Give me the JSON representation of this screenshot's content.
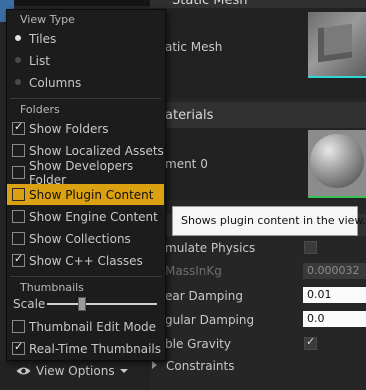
{
  "background": {
    "header_partial": "Static Mesh",
    "mesh_label_partial": "atic Mesh",
    "materials_header_partial": "aterials",
    "element_label_partial": "ment 0",
    "props": [
      {
        "label": "mulate Physics",
        "type": "check",
        "checked": false
      },
      {
        "label": "MassInKg",
        "type": "field",
        "value": "0.000032",
        "dim": true
      },
      {
        "label": "ear Damping",
        "type": "field",
        "value": "0.01"
      },
      {
        "label": "gular Damping",
        "type": "field",
        "value": "0.0"
      },
      {
        "label": "ble Gravity",
        "type": "check",
        "checked": true
      }
    ],
    "constraints_label": "Constraints"
  },
  "menu": {
    "view_type": {
      "title": "View Type",
      "options": [
        {
          "label": "Tiles",
          "selected": true
        },
        {
          "label": "List",
          "selected": false
        },
        {
          "label": "Columns",
          "selected": false
        }
      ]
    },
    "folders": {
      "title": "Folders",
      "items": [
        {
          "label": "Show Folders",
          "checked": true
        },
        {
          "label": "Show Localized Assets",
          "checked": false
        },
        {
          "label": "Show Developers Folder",
          "checked": false
        },
        {
          "label": "Show Plugin Content",
          "checked": false,
          "highlighted": true
        },
        {
          "label": "Show Engine Content",
          "checked": false
        },
        {
          "label": "Show Collections",
          "checked": false
        },
        {
          "label": "Show C++ Classes",
          "checked": true
        }
      ]
    },
    "thumbnails": {
      "title": "Thumbnails",
      "scale_label": "Scale",
      "scale_value": 0.3,
      "items": [
        {
          "label": "Thumbnail Edit Mode",
          "checked": false
        },
        {
          "label": "Real-Time Thumbnails",
          "checked": true
        }
      ]
    }
  },
  "bottom_bar": {
    "view_options_label": "View Options",
    "icon": "eye-icon"
  },
  "tooltip": {
    "text": "Shows plugin content in the view."
  },
  "colors": {
    "highlight": "#dba110",
    "mesh_accent": "#2fd6d6",
    "material_accent": "#35c452"
  }
}
